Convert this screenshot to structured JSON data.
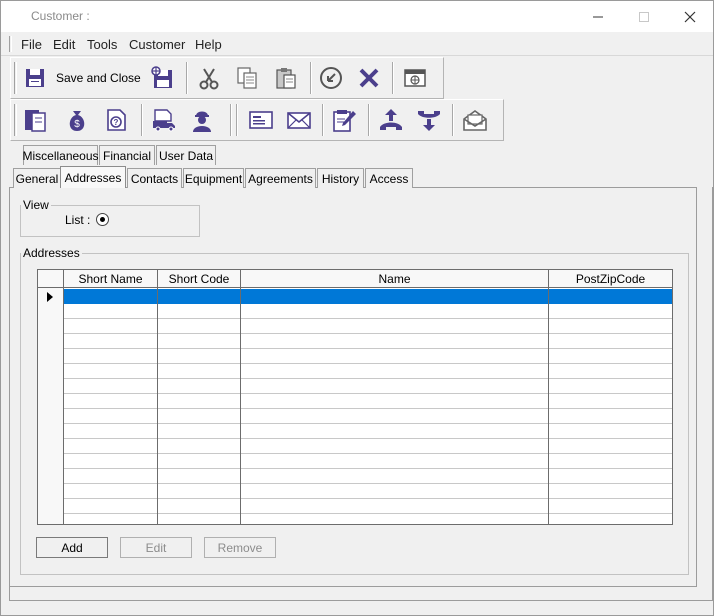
{
  "window": {
    "title": "Customer :",
    "controls": {
      "minimize": "—",
      "maximize": "☐",
      "close": "✕"
    }
  },
  "menu": {
    "items": [
      "File",
      "Edit",
      "Tools",
      "Customer",
      "Help"
    ]
  },
  "toolbar1": {
    "save_close_label": "Save and Close",
    "icons": [
      "save-icon",
      "save-new-icon",
      "cut-icon",
      "copy-icon",
      "paste-icon",
      "undo-icon",
      "delete-icon",
      "browser-window-icon"
    ]
  },
  "toolbar2": {
    "icons": [
      "ledger-book-icon",
      "money-bag-icon",
      "help-document-icon",
      "delivery-truck-icon",
      "service-person-icon",
      "address-card-icon",
      "mail-envelope-icon",
      "edit-notes-icon",
      "outgoing-call-icon",
      "incoming-call-icon",
      "open-envelope-icon"
    ]
  },
  "tabs": {
    "row_top": [
      "Miscellaneous",
      "Financial",
      "User Data"
    ],
    "row_bottom": [
      "General",
      "Addresses",
      "Contacts",
      "Equipment",
      "Agreements",
      "History",
      "Access"
    ],
    "active": "Addresses"
  },
  "view_group": {
    "legend": "View",
    "list_label": "List :",
    "list_selected": true
  },
  "addresses_group": {
    "legend": "Addresses",
    "columns": [
      "Short Name",
      "Short Code",
      "Name",
      "PostZipCode"
    ],
    "rows": [
      [
        "",
        "",
        "",
        ""
      ],
      [
        "",
        "",
        "",
        ""
      ],
      [
        "",
        "",
        "",
        ""
      ],
      [
        "",
        "",
        "",
        ""
      ],
      [
        "",
        "",
        "",
        ""
      ],
      [
        "",
        "",
        "",
        ""
      ],
      [
        "",
        "",
        "",
        ""
      ],
      [
        "",
        "",
        "",
        ""
      ],
      [
        "",
        "",
        "",
        ""
      ],
      [
        "",
        "",
        "",
        ""
      ],
      [
        "",
        "",
        "",
        ""
      ],
      [
        "",
        "",
        "",
        ""
      ],
      [
        "",
        "",
        "",
        ""
      ],
      [
        "",
        "",
        "",
        ""
      ],
      [
        "",
        "",
        "",
        ""
      ]
    ],
    "selected_row": 0
  },
  "buttons": {
    "add": "Add",
    "edit": "Edit",
    "remove": "Remove"
  },
  "colors": {
    "icon_purple": "#4b3f8c",
    "selection_blue": "#0078d7"
  }
}
